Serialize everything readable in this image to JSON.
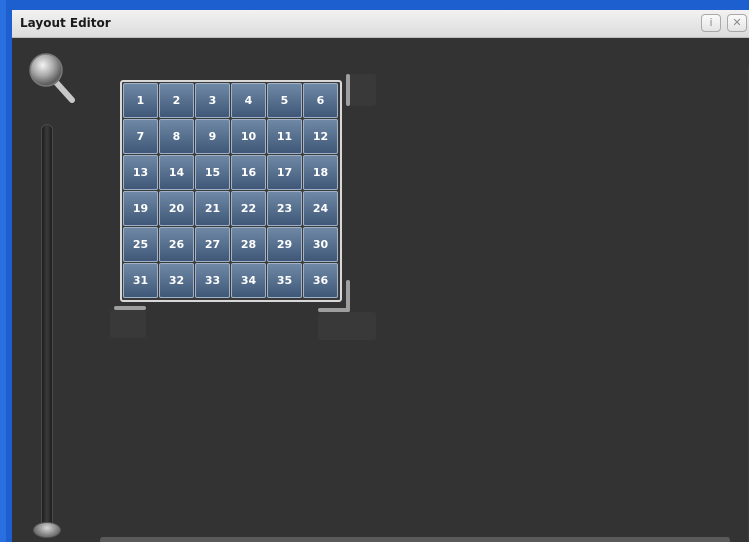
{
  "window": {
    "title": "Layout Editor",
    "info_button": "i",
    "close_button": "✕"
  },
  "zoom": {
    "icon": "magnifier-icon",
    "slider_level": 0.0
  },
  "grid": {
    "rows": 6,
    "cols": 6,
    "cells": [
      "1",
      "2",
      "3",
      "4",
      "5",
      "6",
      "7",
      "8",
      "9",
      "10",
      "11",
      "12",
      "13",
      "14",
      "15",
      "16",
      "17",
      "18",
      "19",
      "20",
      "21",
      "22",
      "23",
      "24",
      "25",
      "26",
      "27",
      "28",
      "29",
      "30",
      "31",
      "32",
      "33",
      "34",
      "35",
      "36"
    ]
  },
  "colors": {
    "background": "#333333",
    "cell_top": "#6f88a6",
    "cell_bottom": "#3f5877",
    "window_border": "#2a6fe0"
  }
}
